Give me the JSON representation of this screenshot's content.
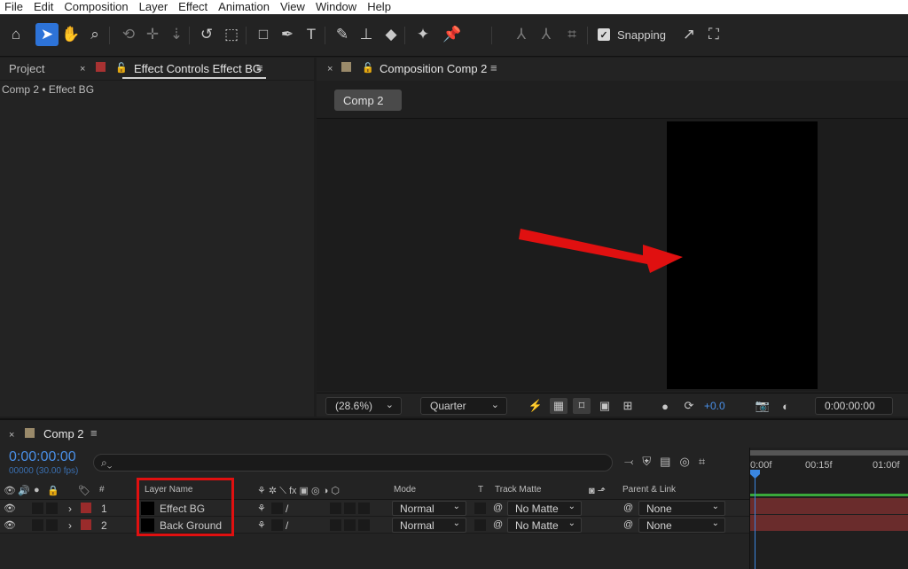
{
  "menu": [
    "File",
    "Edit",
    "Composition",
    "Layer",
    "Effect",
    "Animation",
    "View",
    "Window",
    "Help"
  ],
  "toolbar": {
    "snapping_label": "Snapping",
    "snapping_checked": true
  },
  "left_panel": {
    "tab_project": "Project",
    "tab_effect_controls": "Effect Controls Effect BG",
    "breadcrumb": "Comp 2 • Effect BG"
  },
  "comp_panel": {
    "tab_label": "Composition Comp 2",
    "comp_button": "Comp 2",
    "zoom": "(28.6%)",
    "resolution": "Quarter",
    "exposure": "+0.0",
    "timecode": "0:00:00:00"
  },
  "timeline": {
    "tab_label": "Comp 2",
    "timecode": "0:00:00:00",
    "fps": "00000 (30.00 fps)",
    "search_placeholder": "⌕⌄",
    "columns": {
      "number": "#",
      "layer_name": "Layer Name",
      "mode": "Mode",
      "t": "T",
      "track_matte": "Track Matte",
      "parent_link": "Parent & Link"
    },
    "layers": [
      {
        "num": "1",
        "name": "Effect BG",
        "mode": "Normal",
        "matte": "No Matte",
        "parent": "None"
      },
      {
        "num": "2",
        "name": "Back Ground",
        "mode": "Normal",
        "matte": "No Matte",
        "parent": "None"
      }
    ],
    "ruler": [
      "0:00f",
      "00:15f",
      "01:00f"
    ]
  },
  "colors": {
    "accent": "#2d73d8",
    "timecode": "#4a90e8",
    "label_red": "#9a2b2b",
    "annotation_red": "#e01010"
  }
}
